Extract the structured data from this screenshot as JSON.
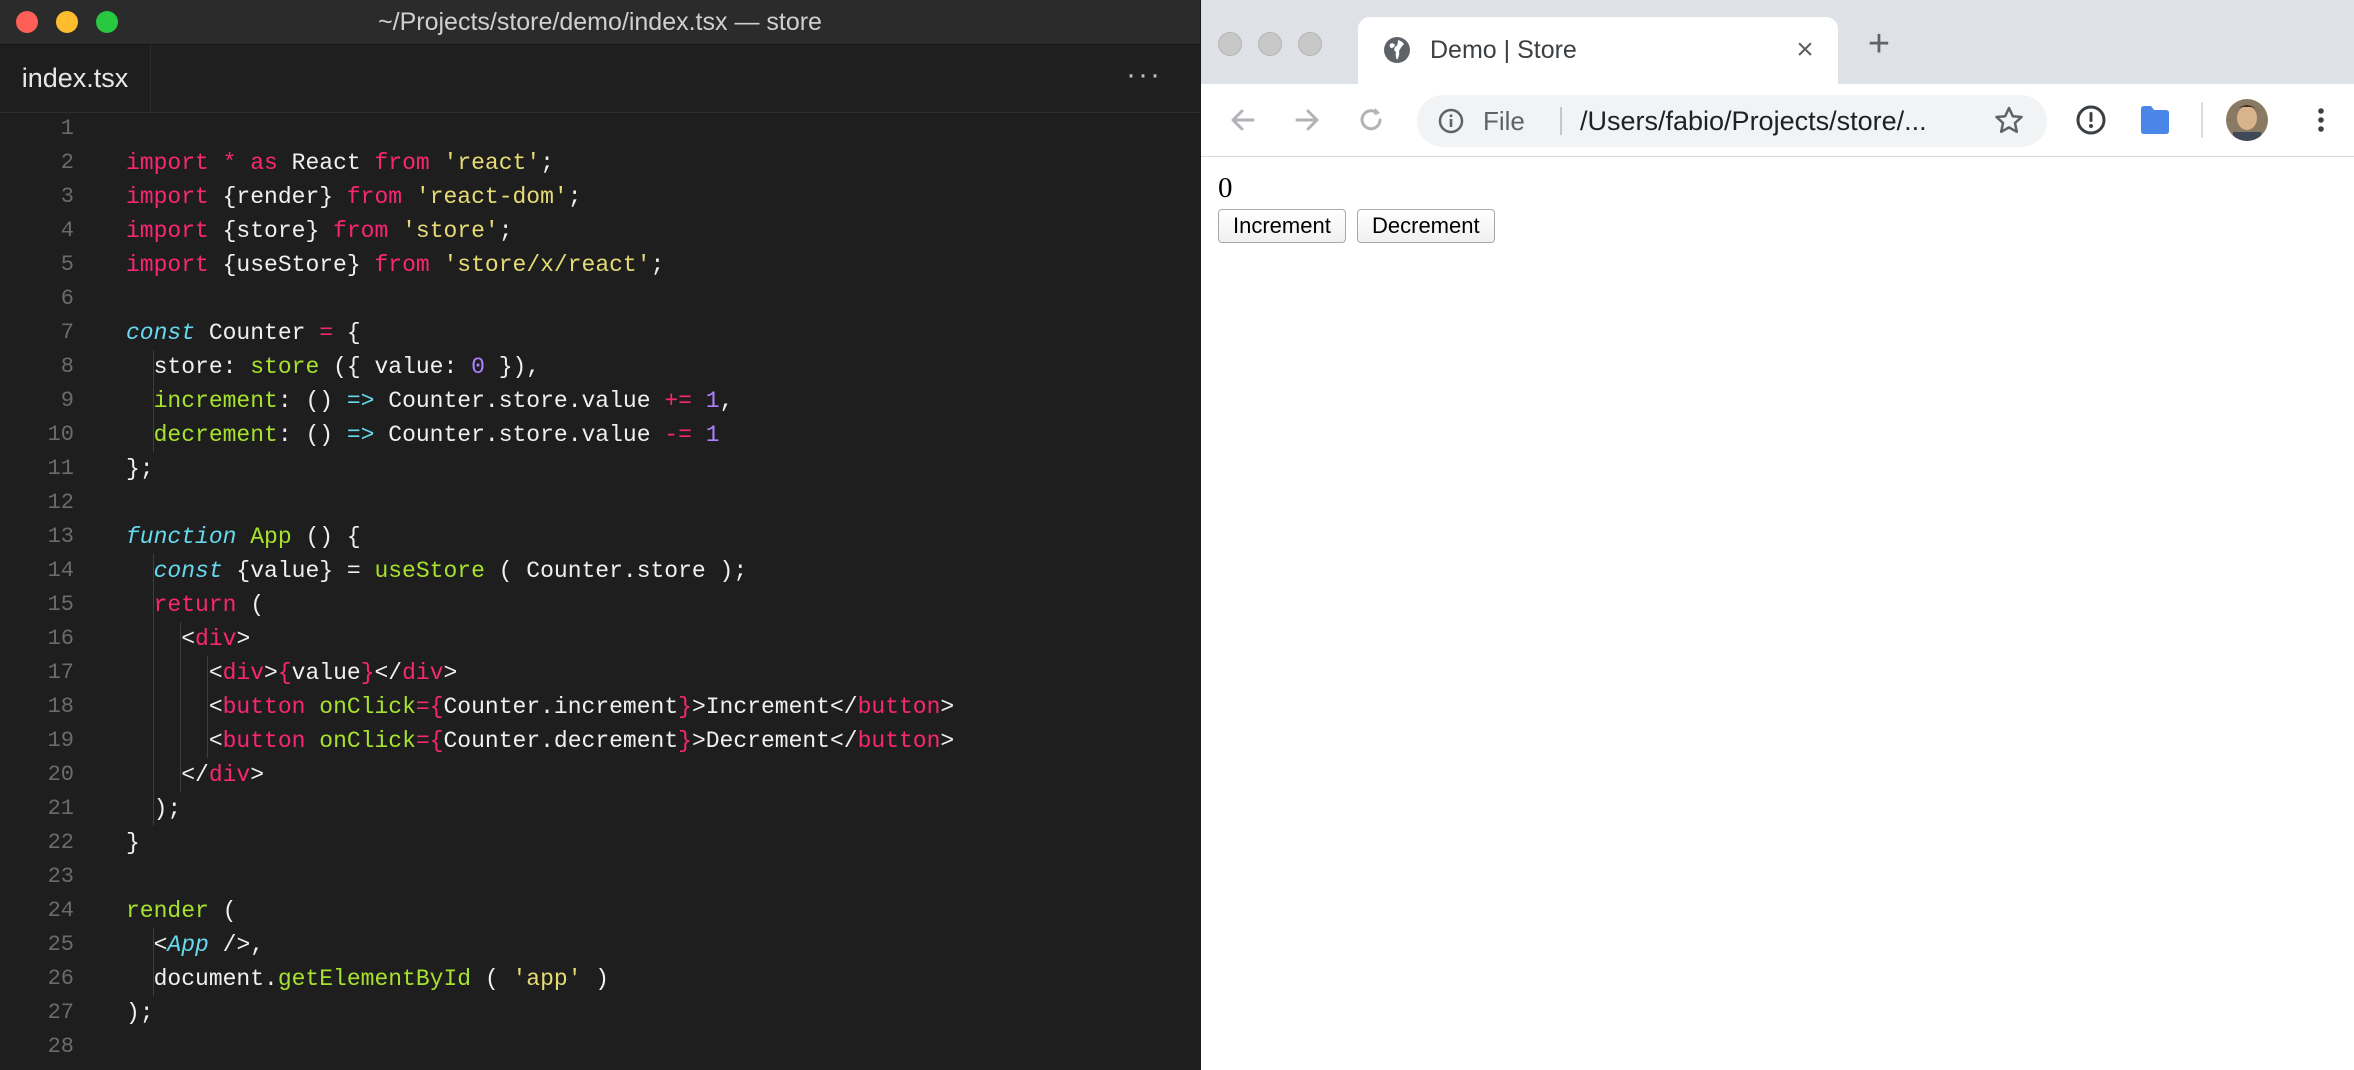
{
  "editor": {
    "window_title": "~/Projects/store/demo/index.tsx — store",
    "tab_label": "index.tsx",
    "more_label": "···",
    "lines": [
      {
        "n": "1",
        "g": 0,
        "t": []
      },
      {
        "n": "2",
        "g": 0,
        "t": [
          [
            "k",
            "import"
          ],
          [
            "",
            ""
          ],
          [
            "k",
            " * "
          ],
          [
            "k",
            "as"
          ],
          [
            "",
            " React "
          ],
          [
            "k",
            "from"
          ],
          [
            "",
            " "
          ],
          [
            "s",
            "'react'"
          ],
          [
            "",
            ";"
          ]
        ]
      },
      {
        "n": "3",
        "g": 0,
        "t": [
          [
            "k",
            "import"
          ],
          [
            "",
            " {render} "
          ],
          [
            "k",
            "from"
          ],
          [
            "",
            " "
          ],
          [
            "s",
            "'react-dom'"
          ],
          [
            "",
            ";"
          ]
        ]
      },
      {
        "n": "4",
        "g": 0,
        "t": [
          [
            "k",
            "import"
          ],
          [
            "",
            " {store} "
          ],
          [
            "k",
            "from"
          ],
          [
            "",
            " "
          ],
          [
            "s",
            "'store'"
          ],
          [
            "",
            ";"
          ]
        ]
      },
      {
        "n": "5",
        "g": 0,
        "t": [
          [
            "k",
            "import"
          ],
          [
            "",
            " {useStore} "
          ],
          [
            "k",
            "from"
          ],
          [
            "",
            " "
          ],
          [
            "s",
            "'store/x/react'"
          ],
          [
            "",
            ";"
          ]
        ]
      },
      {
        "n": "6",
        "g": 0,
        "t": []
      },
      {
        "n": "7",
        "g": 0,
        "t": [
          [
            "c",
            "const"
          ],
          [
            "",
            " Counter "
          ],
          [
            "k",
            "="
          ],
          [
            "",
            " {"
          ]
        ]
      },
      {
        "n": "8",
        "g": 1,
        "t": [
          [
            "",
            "  store: "
          ],
          [
            "f",
            "store"
          ],
          [
            "",
            " ({ value: "
          ],
          [
            "n",
            "0"
          ],
          [
            "",
            " }),"
          ]
        ]
      },
      {
        "n": "9",
        "g": 1,
        "t": [
          [
            "",
            "  "
          ],
          [
            "f",
            "increment"
          ],
          [
            "",
            ": () "
          ],
          [
            "a",
            "=>"
          ],
          [
            "",
            " Counter.store.value "
          ],
          [
            "k",
            "+="
          ],
          [
            "",
            " "
          ],
          [
            "n",
            "1"
          ],
          [
            "",
            ","
          ]
        ]
      },
      {
        "n": "10",
        "g": 1,
        "t": [
          [
            "",
            "  "
          ],
          [
            "f",
            "decrement"
          ],
          [
            "",
            ": () "
          ],
          [
            "a",
            "=>"
          ],
          [
            "",
            " Counter.store.value "
          ],
          [
            "k",
            "-="
          ],
          [
            "",
            " "
          ],
          [
            "n",
            "1"
          ]
        ]
      },
      {
        "n": "11",
        "g": 0,
        "t": [
          [
            "",
            "};"
          ]
        ]
      },
      {
        "n": "12",
        "g": 0,
        "t": []
      },
      {
        "n": "13",
        "g": 0,
        "t": [
          [
            "c",
            "function"
          ],
          [
            "",
            " "
          ],
          [
            "f",
            "App"
          ],
          [
            "",
            " () {"
          ]
        ]
      },
      {
        "n": "14",
        "g": 1,
        "t": [
          [
            "",
            "  "
          ],
          [
            "c",
            "const"
          ],
          [
            "",
            " {value} = "
          ],
          [
            "f",
            "useStore"
          ],
          [
            "",
            " ( Counter.store );"
          ]
        ]
      },
      {
        "n": "15",
        "g": 1,
        "t": [
          [
            "",
            "  "
          ],
          [
            "k",
            "return"
          ],
          [
            "",
            " ("
          ]
        ]
      },
      {
        "n": "16",
        "g": 2,
        "t": [
          [
            "",
            "    <"
          ],
          [
            "k",
            "div"
          ],
          [
            "",
            ">"
          ]
        ]
      },
      {
        "n": "17",
        "g": 3,
        "t": [
          [
            "",
            "      <"
          ],
          [
            "k",
            "div"
          ],
          [
            "",
            ">"
          ],
          [
            "k",
            "{"
          ],
          [
            "",
            "value"
          ],
          [
            "k",
            "}"
          ],
          [
            "",
            "</"
          ],
          [
            "k",
            "div"
          ],
          [
            "",
            ">"
          ]
        ]
      },
      {
        "n": "18",
        "g": 3,
        "t": [
          [
            "",
            "      <"
          ],
          [
            "k",
            "button"
          ],
          [
            "",
            " "
          ],
          [
            "f",
            "onClick"
          ],
          [
            "k",
            "={"
          ],
          [
            "",
            "Counter.increment"
          ],
          [
            "k",
            "}"
          ],
          [
            "",
            ">Increment</"
          ],
          [
            "k",
            "button"
          ],
          [
            "",
            ">"
          ]
        ]
      },
      {
        "n": "19",
        "g": 3,
        "t": [
          [
            "",
            "      <"
          ],
          [
            "k",
            "button"
          ],
          [
            "",
            " "
          ],
          [
            "f",
            "onClick"
          ],
          [
            "k",
            "={"
          ],
          [
            "",
            "Counter.decrement"
          ],
          [
            "k",
            "}"
          ],
          [
            "",
            ">Decrement</"
          ],
          [
            "k",
            "button"
          ],
          [
            "",
            ">"
          ]
        ]
      },
      {
        "n": "20",
        "g": 2,
        "t": [
          [
            "",
            "    </"
          ],
          [
            "k",
            "div"
          ],
          [
            "",
            ">"
          ]
        ]
      },
      {
        "n": "21",
        "g": 1,
        "t": [
          [
            "",
            "  );"
          ]
        ]
      },
      {
        "n": "22",
        "g": 0,
        "t": [
          [
            "",
            "}"
          ]
        ]
      },
      {
        "n": "23",
        "g": 0,
        "t": []
      },
      {
        "n": "24",
        "g": 0,
        "t": [
          [
            "f",
            "render"
          ],
          [
            "",
            " ("
          ]
        ]
      },
      {
        "n": "25",
        "g": 1,
        "t": [
          [
            "",
            "  <"
          ],
          [
            "c",
            "App"
          ],
          [
            "",
            " />,"
          ]
        ]
      },
      {
        "n": "26",
        "g": 1,
        "t": [
          [
            "",
            "  document."
          ],
          [
            "f",
            "getElementById"
          ],
          [
            "",
            " ( "
          ],
          [
            "s",
            "'app'"
          ],
          [
            "",
            " )"
          ]
        ]
      },
      {
        "n": "27",
        "g": 0,
        "t": [
          [
            "",
            ");"
          ]
        ]
      },
      {
        "n": "28",
        "g": 0,
        "t": []
      }
    ]
  },
  "browser": {
    "tab_title": "Demo | Store",
    "omnibox": {
      "scheme": "File",
      "url": "/Users/fabio/Projects/store/..."
    },
    "page": {
      "counter_value": "0",
      "increment_label": "Increment",
      "decrement_label": "Decrement"
    }
  },
  "icons": {
    "tab": [
      "globe-icon",
      "close-icon",
      "plus-icon"
    ],
    "toolbar": [
      "back-arrow-icon",
      "forward-arrow-icon",
      "reload-icon",
      "info-icon",
      "star-icon",
      "password-key-icon",
      "extension-icon",
      "avatar",
      "kebab-menu-icon"
    ]
  }
}
